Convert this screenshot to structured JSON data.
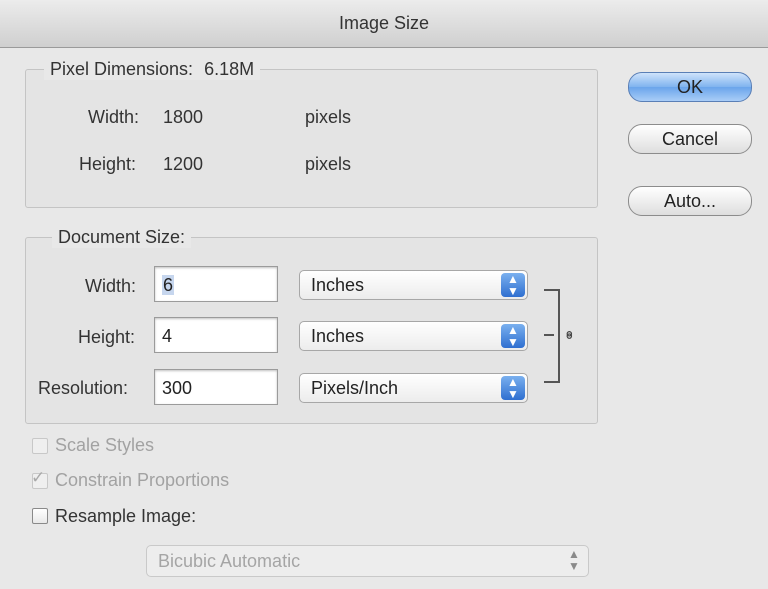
{
  "dialog": {
    "title": "Image Size"
  },
  "pixel_dimensions": {
    "legend": "Pixel Dimensions:",
    "size": "6.18M",
    "width_label": "Width:",
    "width_value": "1800",
    "width_unit": "pixels",
    "height_label": "Height:",
    "height_value": "1200",
    "height_unit": "pixels"
  },
  "document_size": {
    "legend": "Document Size:",
    "width_label": "Width:",
    "width_value": "6",
    "width_unit": "Inches",
    "height_label": "Height:",
    "height_value": "4",
    "height_unit": "Inches",
    "resolution_label": "Resolution:",
    "resolution_value": "300",
    "resolution_unit": "Pixels/Inch"
  },
  "buttons": {
    "ok": "OK",
    "cancel": "Cancel",
    "auto": "Auto..."
  },
  "options": {
    "scale_styles": "Scale Styles",
    "scale_styles_checked": false,
    "constrain_proportions": "Constrain Proportions",
    "constrain_proportions_checked": true,
    "resample_image": "Resample Image:",
    "resample_image_checked": false,
    "resample_method": "Bicubic Automatic"
  },
  "colors": {
    "accent": "#3d7fd9",
    "default_button": "#7fb3ef"
  },
  "icons": {
    "popup_arrows": "up-down-arrows-icon",
    "link": "chain-link-icon",
    "checkmark": "checkmark-icon"
  }
}
